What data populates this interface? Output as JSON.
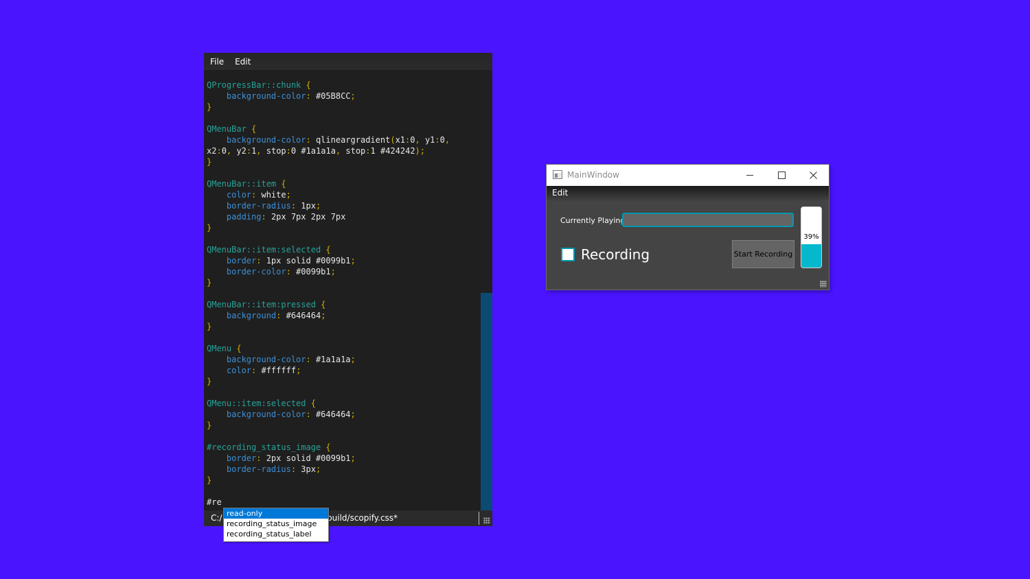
{
  "editor": {
    "menu": [
      "File",
      "Edit"
    ],
    "code_lines": [
      [
        {
          "t": "QProgressBar::chunk ",
          "c": "sel"
        },
        {
          "t": "{",
          "c": "brace"
        }
      ],
      [
        {
          "t": "    background-color",
          "c": "prop"
        },
        {
          "t": ": ",
          "c": "punc"
        },
        {
          "t": "#05B8CC",
          "c": "val"
        },
        {
          "t": ";",
          "c": "punc"
        }
      ],
      [
        {
          "t": "}",
          "c": "brace"
        }
      ],
      [],
      [
        {
          "t": "QMenuBar ",
          "c": "sel"
        },
        {
          "t": "{",
          "c": "brace"
        }
      ],
      [
        {
          "t": "    background-color",
          "c": "prop"
        },
        {
          "t": ": ",
          "c": "punc"
        },
        {
          "t": "qlineargradient",
          "c": "val"
        },
        {
          "t": "(",
          "c": "punc"
        },
        {
          "t": "x1",
          "c": "val"
        },
        {
          "t": ":",
          "c": "punc"
        },
        {
          "t": "0",
          "c": "val"
        },
        {
          "t": ", ",
          "c": "punc"
        },
        {
          "t": "y1",
          "c": "val"
        },
        {
          "t": ":",
          "c": "punc"
        },
        {
          "t": "0",
          "c": "val"
        },
        {
          "t": ",",
          "c": "punc"
        }
      ],
      [
        {
          "t": "x2",
          "c": "val"
        },
        {
          "t": ":",
          "c": "punc"
        },
        {
          "t": "0",
          "c": "val"
        },
        {
          "t": ", ",
          "c": "punc"
        },
        {
          "t": "y2",
          "c": "val"
        },
        {
          "t": ":",
          "c": "punc"
        },
        {
          "t": "1",
          "c": "val"
        },
        {
          "t": ", ",
          "c": "punc"
        },
        {
          "t": "stop",
          "c": "val"
        },
        {
          "t": ":",
          "c": "punc"
        },
        {
          "t": "0 #1a1a1a",
          "c": "val"
        },
        {
          "t": ", ",
          "c": "punc"
        },
        {
          "t": "stop",
          "c": "val"
        },
        {
          "t": ":",
          "c": "punc"
        },
        {
          "t": "1 #424242",
          "c": "val"
        },
        {
          "t": ");",
          "c": "punc"
        }
      ],
      [
        {
          "t": "}",
          "c": "brace"
        }
      ],
      [],
      [
        {
          "t": "QMenuBar::item ",
          "c": "sel"
        },
        {
          "t": "{",
          "c": "brace"
        }
      ],
      [
        {
          "t": "    color",
          "c": "prop"
        },
        {
          "t": ": ",
          "c": "punc"
        },
        {
          "t": "white",
          "c": "val"
        },
        {
          "t": ";",
          "c": "punc"
        }
      ],
      [
        {
          "t": "    border-radius",
          "c": "prop"
        },
        {
          "t": ": ",
          "c": "punc"
        },
        {
          "t": "1px",
          "c": "val"
        },
        {
          "t": ";",
          "c": "punc"
        }
      ],
      [
        {
          "t": "    padding",
          "c": "prop"
        },
        {
          "t": ": ",
          "c": "punc"
        },
        {
          "t": "2px 7px 2px 7px",
          "c": "val"
        }
      ],
      [
        {
          "t": "}",
          "c": "brace"
        }
      ],
      [],
      [
        {
          "t": "QMenuBar::item:selected ",
          "c": "sel"
        },
        {
          "t": "{",
          "c": "brace"
        }
      ],
      [
        {
          "t": "    border",
          "c": "prop"
        },
        {
          "t": ": ",
          "c": "punc"
        },
        {
          "t": "1px solid #0099b1",
          "c": "val"
        },
        {
          "t": ";",
          "c": "punc"
        }
      ],
      [
        {
          "t": "    border-color",
          "c": "prop"
        },
        {
          "t": ": ",
          "c": "punc"
        },
        {
          "t": "#0099b1",
          "c": "val"
        },
        {
          "t": ";",
          "c": "punc"
        }
      ],
      [
        {
          "t": "}",
          "c": "brace"
        }
      ],
      [],
      [
        {
          "t": "QMenuBar::item:pressed ",
          "c": "sel"
        },
        {
          "t": "{",
          "c": "brace"
        }
      ],
      [
        {
          "t": "    background",
          "c": "prop"
        },
        {
          "t": ": ",
          "c": "punc"
        },
        {
          "t": "#646464",
          "c": "val"
        },
        {
          "t": ";",
          "c": "punc"
        }
      ],
      [
        {
          "t": "}",
          "c": "brace"
        }
      ],
      [],
      [
        {
          "t": "QMenu ",
          "c": "sel"
        },
        {
          "t": "{",
          "c": "brace"
        }
      ],
      [
        {
          "t": "    background-color",
          "c": "prop"
        },
        {
          "t": ": ",
          "c": "punc"
        },
        {
          "t": "#1a1a1a",
          "c": "val"
        },
        {
          "t": ";",
          "c": "punc"
        }
      ],
      [
        {
          "t": "    color",
          "c": "prop"
        },
        {
          "t": ": ",
          "c": "punc"
        },
        {
          "t": "#ffffff",
          "c": "val"
        },
        {
          "t": ";",
          "c": "punc"
        }
      ],
      [
        {
          "t": "}",
          "c": "brace"
        }
      ],
      [],
      [
        {
          "t": "QMenu::item:selected ",
          "c": "sel"
        },
        {
          "t": "{",
          "c": "brace"
        }
      ],
      [
        {
          "t": "    background-color",
          "c": "prop"
        },
        {
          "t": ": ",
          "c": "punc"
        },
        {
          "t": "#646464",
          "c": "val"
        },
        {
          "t": ";",
          "c": "punc"
        }
      ],
      [
        {
          "t": "}",
          "c": "brace"
        }
      ],
      [],
      [
        {
          "t": "#recording_status_image ",
          "c": "sel"
        },
        {
          "t": "{",
          "c": "brace"
        }
      ],
      [
        {
          "t": "    border",
          "c": "prop"
        },
        {
          "t": ": ",
          "c": "punc"
        },
        {
          "t": "2px solid #0099b1",
          "c": "val"
        },
        {
          "t": ";",
          "c": "punc"
        }
      ],
      [
        {
          "t": "    border-radius",
          "c": "prop"
        },
        {
          "t": ": ",
          "c": "punc"
        },
        {
          "t": "3px",
          "c": "val"
        },
        {
          "t": ";",
          "c": "punc"
        }
      ],
      [
        {
          "t": "}",
          "c": "brace"
        }
      ],
      [],
      [
        {
          "t": "#re",
          "c": "val"
        }
      ]
    ],
    "status_path": "C:/                                     e/build/scopify.css*",
    "completer": {
      "options": [
        "read-only",
        "recording_status_image",
        "recording_status_label"
      ],
      "selected_index": 0
    }
  },
  "mainwindow": {
    "title": "MainWindow",
    "menu": {
      "edit": "Edit"
    },
    "currently_playing_label": "Currently Playing:",
    "currently_playing_value": "",
    "recording_label": "Recording",
    "recording_checked": false,
    "start_button_label": "Start Recording",
    "progress": {
      "value": 39,
      "text": "39%"
    }
  },
  "colors": {
    "desktop": "#4a14ff",
    "accent": "#0099b1",
    "chunk": "#05B8CC",
    "selector": "#26a39a",
    "property": "#3d8fd6",
    "brace": "#d4b400"
  },
  "icons": [
    "app-window-icon",
    "minimize-icon",
    "maximize-icon",
    "close-icon",
    "size-grip-icon"
  ]
}
